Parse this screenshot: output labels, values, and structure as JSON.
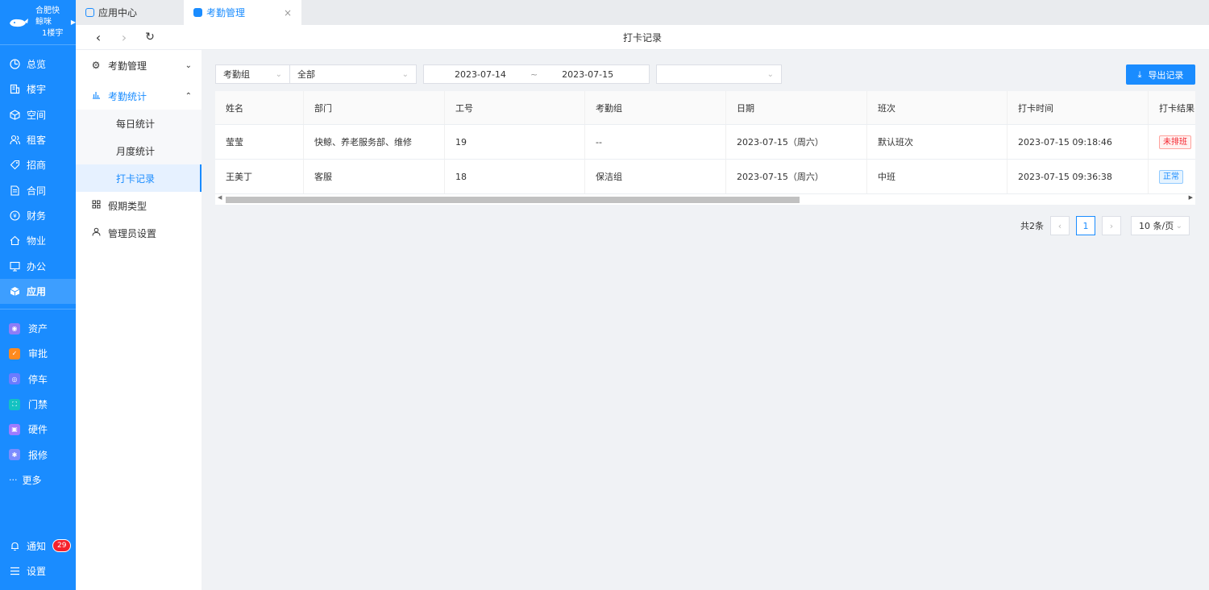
{
  "brand": {
    "name": "合肥快鲸咪",
    "building": "1楼宇"
  },
  "nav": {
    "main": [
      {
        "label": "总览",
        "icon": "dashboard-icon"
      },
      {
        "label": "楼宇",
        "icon": "building-icon"
      },
      {
        "label": "空间",
        "icon": "cube-icon"
      },
      {
        "label": "租客",
        "icon": "users-icon"
      },
      {
        "label": "招商",
        "icon": "tag-icon"
      },
      {
        "label": "合同",
        "icon": "document-icon"
      },
      {
        "label": "财务",
        "icon": "finance-icon"
      },
      {
        "label": "物业",
        "icon": "home-icon"
      },
      {
        "label": "办公",
        "icon": "monitor-icon"
      },
      {
        "label": "应用",
        "icon": "app-icon"
      }
    ],
    "apps": [
      {
        "label": "资产",
        "color": "#8f7cf7"
      },
      {
        "label": "审批",
        "color": "#ff8a1f"
      },
      {
        "label": "停车",
        "color": "#6c7bff"
      },
      {
        "label": "门禁",
        "color": "#13c2c2"
      },
      {
        "label": "硬件",
        "color": "#9e7bff"
      },
      {
        "label": "报修",
        "color": "#7a8cff"
      }
    ],
    "more": "更多",
    "notify": "通知",
    "notify_count": "29",
    "settings": "设置"
  },
  "tabs": [
    {
      "label": "应用中心"
    },
    {
      "label": "考勤管理"
    }
  ],
  "tab_close": "×",
  "page_title": "打卡记录",
  "submenu": {
    "attendance_mgmt": "考勤管理",
    "attendance_stats": "考勤统计",
    "daily": "每日统计",
    "monthly": "月度统计",
    "punch": "打卡记录",
    "holiday": "假期类型",
    "admin": "管理员设置"
  },
  "filters": {
    "group_label": "考勤组",
    "group_value": "全部",
    "date_start": "2023-07-14",
    "date_sep": "~",
    "date_end": "2023-07-15"
  },
  "export_label": "导出记录",
  "table": {
    "columns": [
      "姓名",
      "部门",
      "工号",
      "考勤组",
      "日期",
      "班次",
      "打卡时间",
      "打卡结果"
    ],
    "rows": [
      {
        "name": "莹莹",
        "dept": "快鲸、养老服务部、维修",
        "id": "19",
        "group": "--",
        "date": "2023-07-15（周六）",
        "shift": "默认班次",
        "time": "2023-07-15 09:18:46",
        "result": "未排班"
      },
      {
        "name": "王美丁",
        "dept": "客服",
        "id": "18",
        "group": "保洁组",
        "date": "2023-07-15（周六）",
        "shift": "中班",
        "time": "2023-07-15 09:36:38",
        "result": "正常"
      }
    ]
  },
  "pager": {
    "total": "共2条",
    "current": "1",
    "size": "10 条/页"
  }
}
